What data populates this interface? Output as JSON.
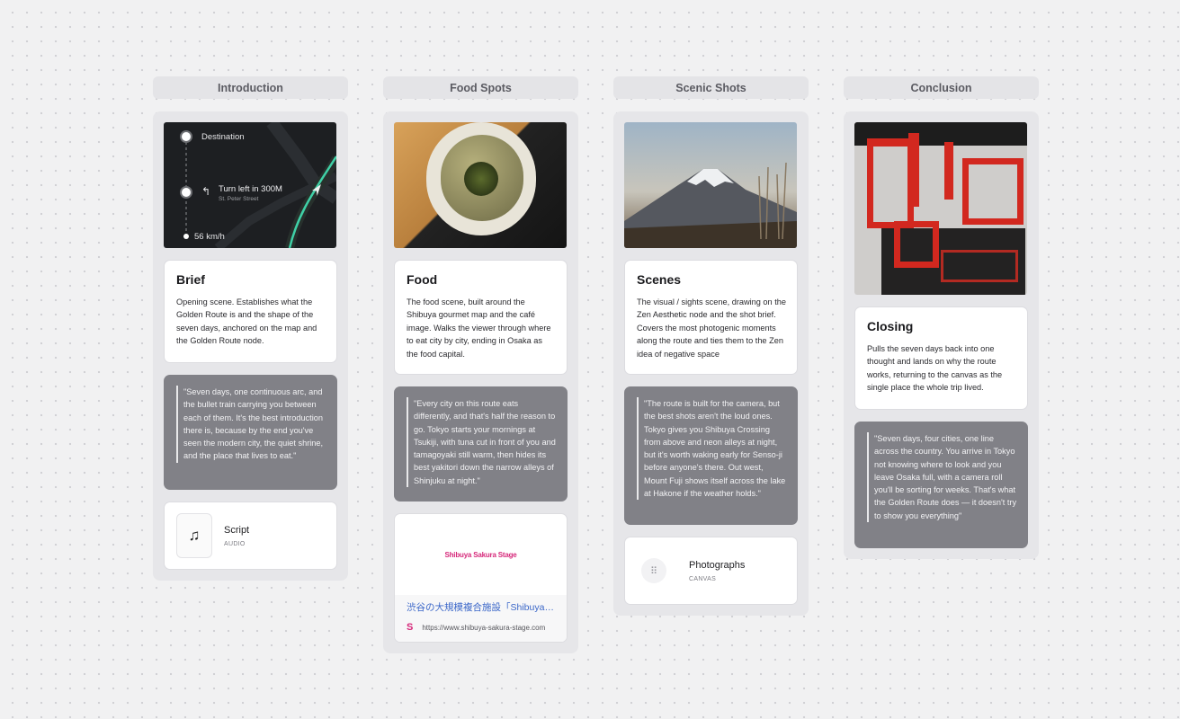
{
  "columns": [
    {
      "header": "Introduction",
      "nav": {
        "destination": "Destination",
        "turn": "Turn left in 300M",
        "street": "St. Peter Street",
        "speed": "56 km/h"
      },
      "card": {
        "title": "Brief",
        "body": "Opening scene. Establishes what the Golden Route is and the shape of the seven days, anchored on the map and the Golden Route node."
      },
      "quote": "\"Seven days, one continuous arc, and the bullet train carrying you between each of them. It's the best introduction there is, because by the end you've seen the modern city, the quiet shrine, and the place that lives to eat.\"",
      "file": {
        "title": "Script",
        "sub": "AUDIO",
        "icon": "music-note-icon"
      }
    },
    {
      "header": "Food Spots",
      "card": {
        "title": "Food",
        "body": "The food scene, built around the Shibuya gourmet map and the café image. Walks the viewer through where to eat city by city, ending in Osaka as the food capital."
      },
      "quote": "\"Every city on this route eats differently, and that's half the reason to go. Tokyo starts your mornings at Tsukiji, with tuna cut in front of you and tamagoyaki still warm, then hides its best yakitori down the narrow alleys of Shinjuku at night.\"",
      "link": {
        "logo": "Shibuya Sakura Stage",
        "title": "渋谷の大規模複合施設「Shibuya Sakura Stage」",
        "url": "https://www.shibuya-sakura-stage.com",
        "favicon": "S"
      }
    },
    {
      "header": "Scenic Shots",
      "card": {
        "title": "Scenes",
        "body": "The visual / sights scene, drawing on the Zen Aesthetic node and the shot brief. Covers the most photogenic moments along the route and ties them to the Zen idea of negative space"
      },
      "quote": "\"The route is built for the camera, but the best shots aren't the loud ones. Tokyo gives you Shibuya Crossing from above and neon alleys at night, but it's worth waking early for Senso-ji before anyone's there. Out west, Mount Fuji shows itself across the lake at Hakone if the weather holds.\"",
      "file": {
        "title": "Photographs",
        "sub": "CANVAS",
        "icon": "grid-dots-icon"
      }
    },
    {
      "header": "Conclusion",
      "card": {
        "title": "Closing",
        "body": "Pulls the seven days back into one thought and lands on why the route works, returning to the canvas as the single place the whole trip lived."
      },
      "quote": "\"Seven days, four cities, one line across the country. You arrive in Tokyo not knowing where to look and you leave Osaka full, with a camera roll you'll be sorting for weeks. That's what the Golden Route does — it doesn't try to show you everything\""
    }
  ]
}
